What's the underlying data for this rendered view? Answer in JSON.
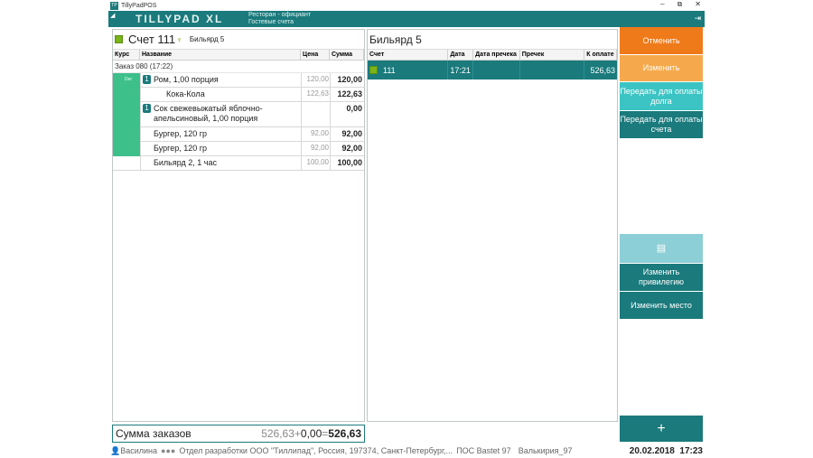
{
  "window": {
    "title": "TillyPadPOS",
    "icon_label": "TP",
    "minimize": "–",
    "restore": "⧉",
    "close": "✕"
  },
  "header": {
    "logo": "TILLYPAD XL",
    "role_line1": "Ресторан - официант",
    "role_line2": "Гостевые счета",
    "exit_icon": "exit-icon"
  },
  "account": {
    "title": "Счет 111",
    "table_name": "Бильярд 5",
    "columns": [
      "Курс",
      "Название",
      "Цена",
      "Сумма"
    ],
    "order_label": "Заказ 080 (17:22)",
    "course_label": "Der",
    "items": [
      {
        "num": "1",
        "name": "Ром, 1,00 порция",
        "price": "120,00",
        "sum": "120,00"
      },
      {
        "num": "",
        "name": "Кока-Кола",
        "price": "122,63",
        "sum": "122,63"
      },
      {
        "num": "1",
        "name": "Сок свежевыжатый яблочно-апельсиновый, 1,00 порция",
        "price": "",
        "sum": "0,00"
      },
      {
        "num": "",
        "name": "Бургер, 120 гр",
        "price": "92,00",
        "sum": "92,00"
      },
      {
        "num": "",
        "name": "Бургер, 120 гр",
        "price": "92,00",
        "sum": "92,00"
      },
      {
        "num": "",
        "name": "Бильярд 2, 1 час",
        "price": "100,00",
        "sum": "100,00"
      }
    ]
  },
  "total": {
    "label": "Сумма заказов",
    "orders": "526,63",
    "plus": "+",
    "extra": "0,00",
    "eq": "=",
    "result": "526,63"
  },
  "bills": {
    "title": "Бильярд 5",
    "columns": [
      "Счет",
      "Дата",
      "Дата пречека",
      "Пречек",
      "К оплате"
    ],
    "rows": [
      {
        "account": "111",
        "date": "17:21",
        "pdate": "",
        "pre": "",
        "pay": "526,63"
      }
    ]
  },
  "buttons": {
    "cancel": "Отменить",
    "change": "Изменить",
    "transfer_debt": "Передать для оплаты долга",
    "transfer_bill": "Передать для оплаты счета",
    "receipt_icon": "receipt-icon",
    "change_privilege": "Изменить привилегию",
    "change_place": "Изменить место",
    "add": "+"
  },
  "status": {
    "user": "Василина",
    "org": "Отдел разработки ООО \"Тиллипад\", Россия, 197374, Санкт-Петербург,...",
    "pos": "ПОС Bastet 97",
    "device": "Валькирия_97",
    "date": "20.02.2018",
    "time": "17:23"
  },
  "colors": {
    "teal": "#1a7a7c",
    "orange": "#ef7a1a",
    "light_orange": "#f6a94c",
    "cyan": "#3cc4c4",
    "green": "#3ec08b",
    "pale_teal": "#8ccfd6"
  }
}
